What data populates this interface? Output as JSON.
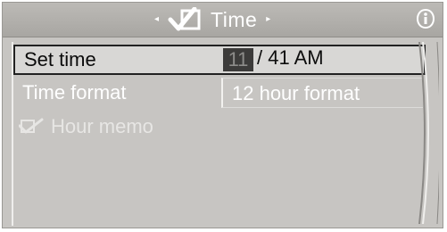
{
  "header": {
    "title": "Time",
    "prev_arrow": "◂",
    "next_arrow": "▸",
    "icon": "clock-check-icon",
    "info_icon": "info-icon"
  },
  "menu": {
    "set_time": {
      "label": "Set time",
      "hour": "11",
      "rest": "/ 41 AM"
    },
    "time_format": {
      "label": "Time format",
      "value": "12 hour format"
    },
    "hour_memo": {
      "label": "Hour memo",
      "icon": "checkbox-check-icon"
    }
  },
  "colors": {
    "background": "#c7c5c2",
    "header": "#aeaca8",
    "highlight_box": "#3c3b3a",
    "text": "#ffffff"
  }
}
